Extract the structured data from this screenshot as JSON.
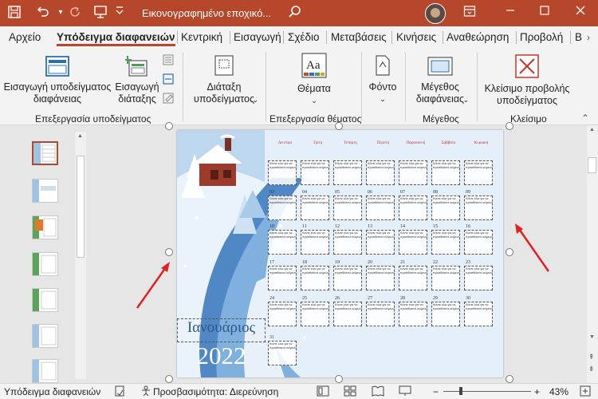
{
  "window": {
    "title": "Εικονογραφημένο εποχικό..."
  },
  "tabs": [
    "Αρχείο",
    "Υπόδειγμα διαφανειών",
    "Κεντρική",
    "Εισαγωγή",
    "Σχέδιο",
    "Μεταβάσεις",
    "Κινήσεις",
    "Αναθεώρηση",
    "Προβολή",
    "Β"
  ],
  "ribbon": {
    "insert_master": "Εισαγωγή υποδείγματος διαφάνειας",
    "insert_layout": "Εισαγωγή διάταξης",
    "group_edit_master": "Επεξεργασία υποδείγματος",
    "master_layout": "Διάταξη υποδείγματος",
    "themes": "Θέματα",
    "group_edit_theme": "Επεξεργασία θέματος",
    "fonts": "Φόντο",
    "slide_size": "Μέγεθος διαφάνειας",
    "group_size": "Μέγεθος",
    "close_view": "Κλείσιμο προβολής υποδείγματος",
    "group_close": "Κλείσιμο"
  },
  "calendar": {
    "days": [
      "Δευτέρα",
      "Τρίτη",
      "Τετάρτη",
      "Πέμπτη",
      "Παρασκευή",
      "Σάββατο",
      "Κυριακή"
    ],
    "cell_text": "Κάντε κλικ για να προσθέσετε κείμενο",
    "weeks": [
      [
        "",
        "",
        "",
        "",
        "",
        "",
        ""
      ],
      [
        "03",
        "04",
        "05",
        "06",
        "07",
        "08",
        "09"
      ],
      [
        "10",
        "11",
        "12",
        "13",
        "14",
        "15",
        "16"
      ],
      [
        "17",
        "18",
        "19",
        "20",
        "21",
        "22",
        "23"
      ],
      [
        "24",
        "25",
        "26",
        "27",
        "28",
        "29",
        "30"
      ],
      [
        "31",
        "",
        "",
        "",
        "",
        "",
        ""
      ]
    ],
    "month": "Ιανουάριος",
    "year": "2022"
  },
  "status": {
    "view": "Υπόδειγμα διαφανειών",
    "accessibility": "Προσβασιμότητα: Διερεύνηση",
    "zoom": "43%"
  },
  "colors": {
    "accent": "#b7472a",
    "calendar_red": "#c0392b",
    "month_blue": "#2c5a8a"
  }
}
